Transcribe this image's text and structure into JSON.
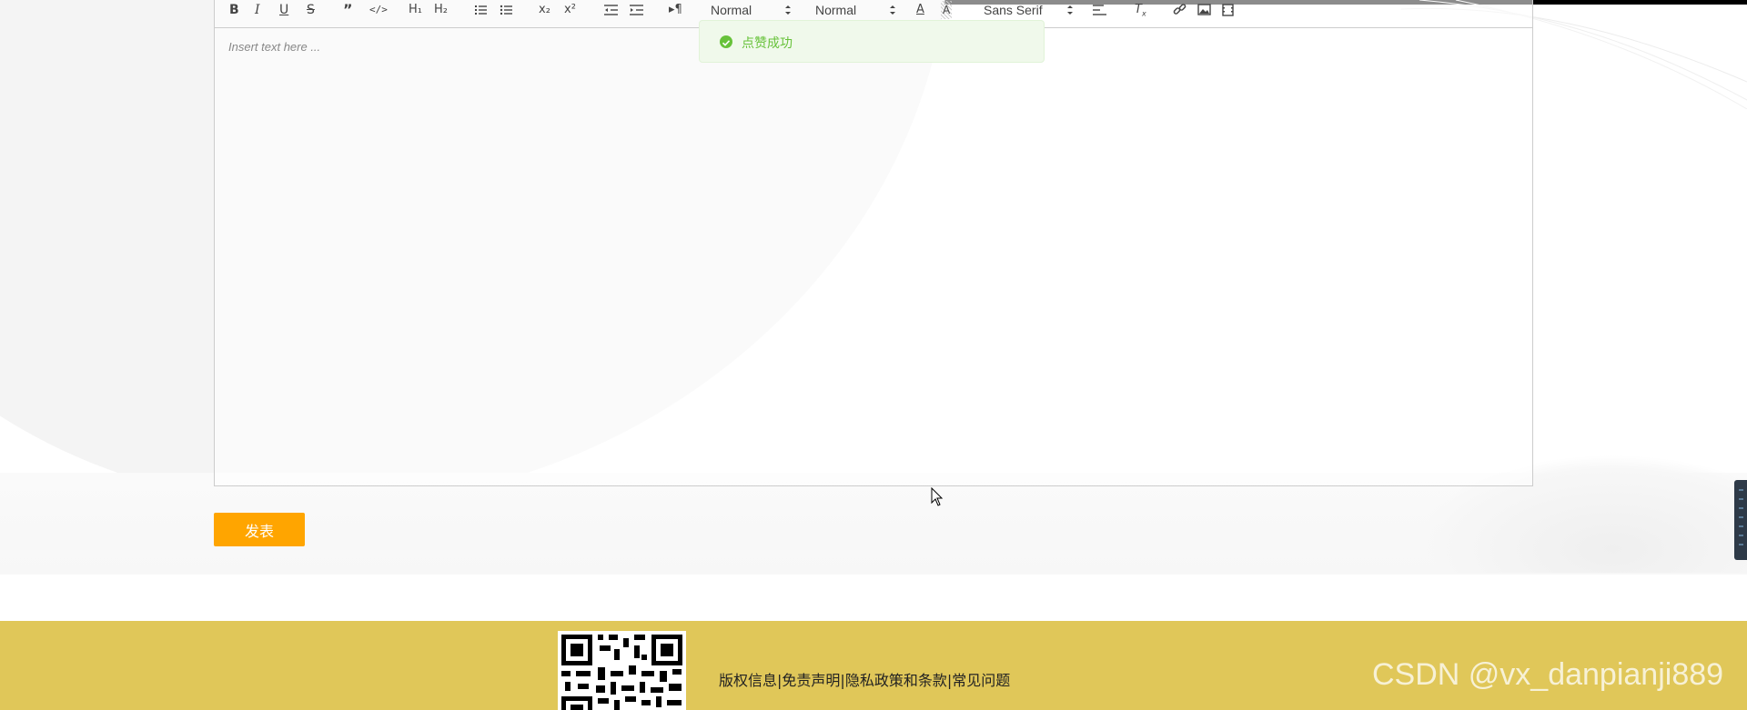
{
  "editor": {
    "placeholder": "Insert text here ...",
    "toolbar": {
      "header_picker": "Normal",
      "size_picker": "Normal",
      "font_picker": "Sans Serif"
    }
  },
  "toast": {
    "message": "点赞成功",
    "icon": "check-circle-icon",
    "color": "#67c23a"
  },
  "actions": {
    "publish_label": "发表",
    "publish_color": "#ffa500"
  },
  "footer": {
    "background": "#e0c759",
    "links": [
      "版权信息",
      "免责声明",
      "隐私政策和条款",
      "常见问题"
    ],
    "separator": "|",
    "watermark": "CSDN @vx_danpianji889"
  }
}
